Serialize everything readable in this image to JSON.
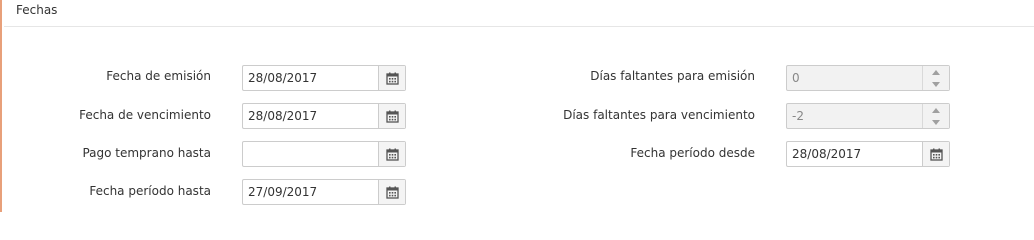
{
  "section": {
    "title": "Fechas"
  },
  "left_fields": [
    {
      "label": "Fecha de emisión",
      "value": "28/08/2017"
    },
    {
      "label": "Fecha de vencimiento",
      "value": "28/08/2017"
    },
    {
      "label": "Pago temprano hasta",
      "value": ""
    },
    {
      "label": "Fecha período hasta",
      "value": "27/09/2017"
    }
  ],
  "right_fields": [
    {
      "label": "Días faltantes para emisión",
      "value": "0"
    },
    {
      "label": "Días faltantes para vencimiento",
      "value": "-2"
    },
    {
      "label": "Fecha período desde",
      "value": "28/08/2017"
    }
  ],
  "icons": {
    "calendar": "calendar-icon",
    "spin_up": "chevron-up-icon",
    "spin_down": "chevron-down-icon"
  },
  "colors": {
    "accent": "#e8a07a",
    "border": "#cccccc",
    "disabled_bg": "#f2f2f2"
  }
}
